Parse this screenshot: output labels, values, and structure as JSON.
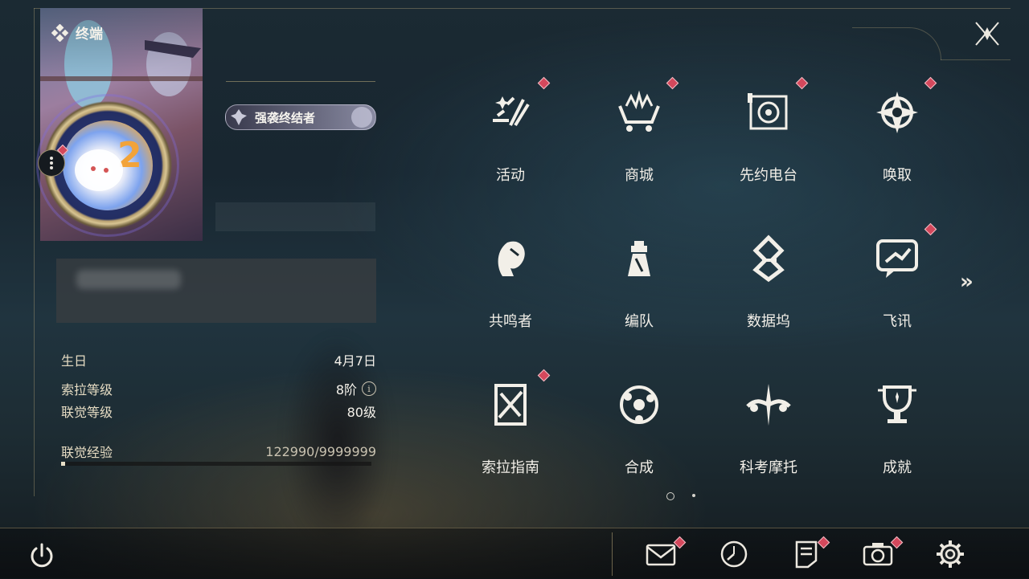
{
  "header": {
    "title": "终端"
  },
  "profile": {
    "title_badge": "强袭终结者"
  },
  "stats": {
    "rows": [
      {
        "label": "生日",
        "value": "4月7日"
      },
      {
        "label": "索拉等级",
        "value": "8阶"
      },
      {
        "label": "联觉等级",
        "value": "80级"
      },
      {
        "label": "联觉经验",
        "value": "122990/9999999"
      }
    ],
    "exp_progress": 0.0123
  },
  "menu": {
    "items": [
      {
        "label": "活动",
        "icon": "activity-icon",
        "badge": true
      },
      {
        "label": "商城",
        "icon": "shop-icon",
        "badge": true
      },
      {
        "label": "先约电台",
        "icon": "radio-icon",
        "badge": true
      },
      {
        "label": "唤取",
        "icon": "convene-icon",
        "badge": true
      },
      {
        "label": "共鸣者",
        "icon": "resonator-icon",
        "badge": false
      },
      {
        "label": "编队",
        "icon": "team-icon",
        "badge": false
      },
      {
        "label": "数据坞",
        "icon": "data-bank-icon",
        "badge": false
      },
      {
        "label": "飞讯",
        "icon": "message-icon",
        "badge": true
      },
      {
        "label": "索拉指南",
        "icon": "guidebook-icon",
        "badge": true
      },
      {
        "label": "合成",
        "icon": "synthesis-icon",
        "badge": false
      },
      {
        "label": "科考摩托",
        "icon": "motorcycle-icon",
        "badge": false
      },
      {
        "label": "成就",
        "icon": "achievement-icon",
        "badge": false
      }
    ],
    "page_count": 2,
    "current_page": 1
  },
  "bottom_bar": {
    "icons": [
      {
        "name": "mail-icon",
        "badge": true
      },
      {
        "name": "clock-icon",
        "badge": false
      },
      {
        "name": "notice-icon",
        "badge": true
      },
      {
        "name": "camera-icon",
        "badge": true
      },
      {
        "name": "settings-icon",
        "badge": false
      }
    ]
  },
  "colors": {
    "accent_gold": "#c8b482",
    "badge_red": "#d4485c",
    "text_light": "#f2efe8"
  }
}
